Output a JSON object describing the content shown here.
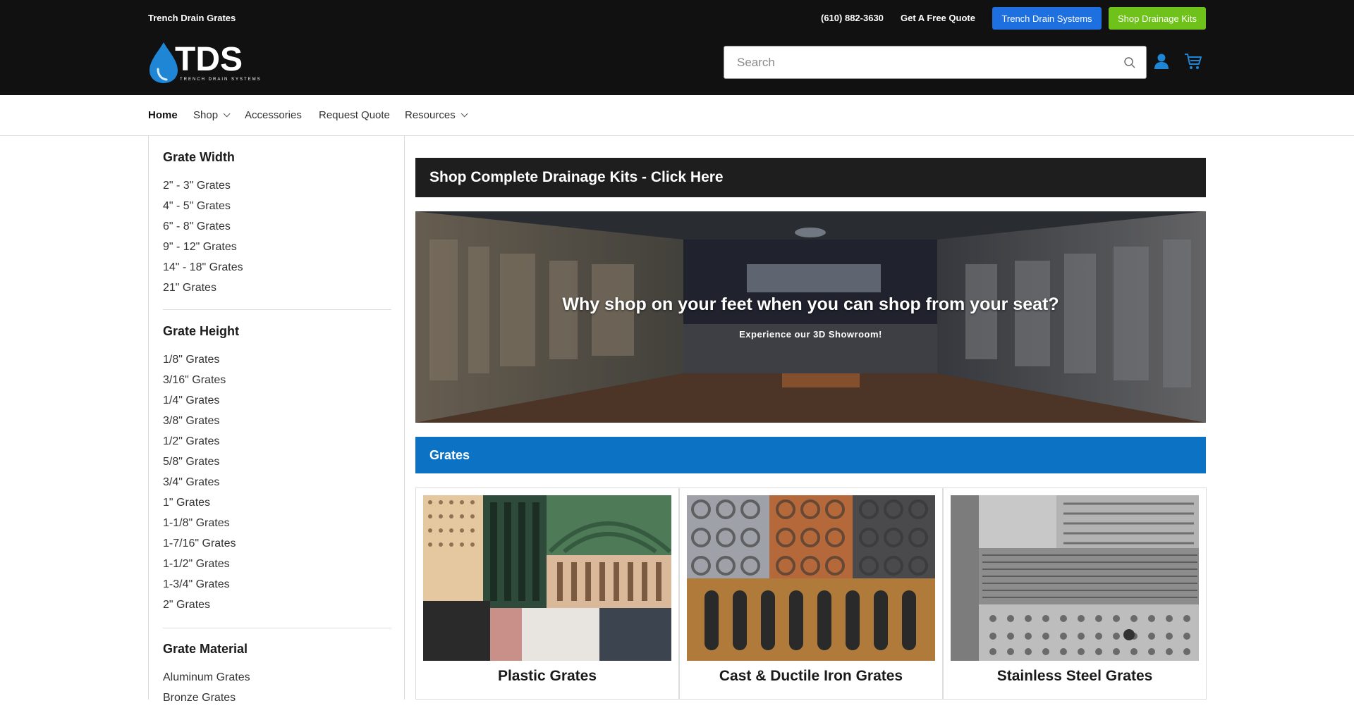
{
  "topbar": {
    "site_name": "Trench Drain Grates",
    "phone": "(610) 882-3630",
    "quote_link": "Get A Free Quote",
    "btn_systems": "Trench Drain Systems",
    "btn_kits": "Shop Drainage Kits",
    "logo_text": "TDS",
    "logo_subtext": "TRENCH DRAIN SYSTEMS"
  },
  "search": {
    "placeholder": "Search"
  },
  "nav": {
    "home": "Home",
    "shop": "Shop",
    "accessories": "Accessories",
    "request_quote": "Request Quote",
    "resources": "Resources"
  },
  "sidebar": {
    "width": {
      "title": "Grate Width",
      "items": [
        "2\" - 3\" Grates",
        "4\" - 5\" Grates",
        "6\" - 8\" Grates",
        "9\" - 12\" Grates",
        "14\" - 18\" Grates",
        "21\" Grates"
      ]
    },
    "height": {
      "title": "Grate Height",
      "items": [
        "1/8\" Grates",
        "3/16\" Grates",
        "1/4\" Grates",
        "3/8\" Grates",
        "1/2\" Grates",
        "5/8\" Grates",
        "3/4\" Grates",
        "1\" Grates",
        "1-1/8\" Grates",
        "1-7/16\" Grates",
        "1-1/2\" Grates",
        "1-3/4\" Grates",
        "2\" Grates"
      ]
    },
    "material": {
      "title": "Grate Material",
      "items": [
        "Aluminum Grates",
        "Bronze Grates"
      ]
    }
  },
  "main": {
    "kits_banner": "Shop Complete Drainage Kits - Click Here",
    "hero_title": "Why shop on your feet when you can shop from your seat?",
    "hero_subtitle": "Experience our 3D Showroom!",
    "grates_header": "Grates",
    "cards": [
      {
        "title": "Plastic Grates"
      },
      {
        "title": "Cast & Ductile Iron Grates"
      },
      {
        "title": "Stainless Steel Grates"
      }
    ]
  },
  "colors": {
    "topbar_bg": "#111111",
    "systems_button": "#1e6fe0",
    "kits_button": "#6fc21a",
    "grates_bar": "#0b72c4",
    "kits_bar": "#1e1e1e"
  }
}
